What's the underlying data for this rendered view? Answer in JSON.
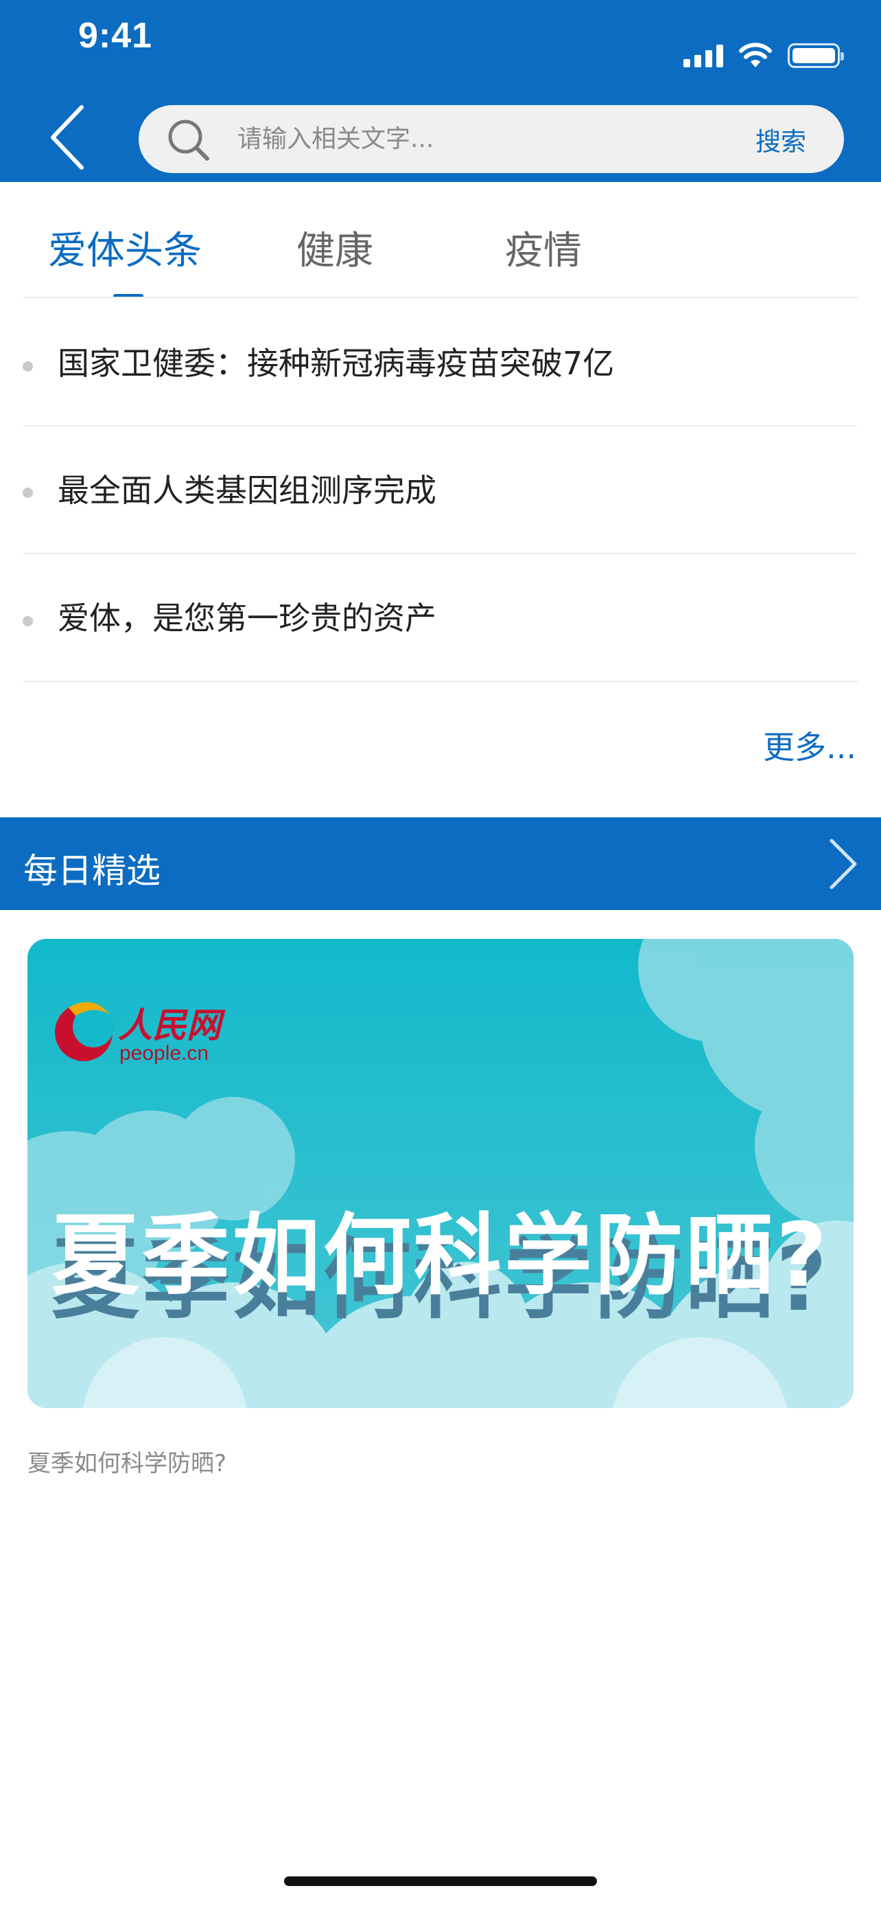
{
  "status_bar": {
    "time": "9:41",
    "icons": [
      "signal-icon",
      "wifi-icon",
      "battery-icon"
    ],
    "battery_level": 1.0
  },
  "search": {
    "placeholder": "请输入相关文字...",
    "value": "",
    "submit_label": "搜索",
    "back_icon": "chevron-left-icon",
    "search_icon": "magnifier-icon"
  },
  "tabs": [
    {
      "label": "爱体头条",
      "active": true
    },
    {
      "label": "健康",
      "active": false
    },
    {
      "label": "疫情",
      "active": false
    }
  ],
  "news": [
    {
      "title": "国家卫健委：接种新冠病毒疫苗突破7亿"
    },
    {
      "title": "最全面人类基因组测序完成"
    },
    {
      "title": "爱体，是您第一珍贵的资产"
    }
  ],
  "more_label": "更多...",
  "section": {
    "title": "每日精选",
    "arrow_icon": "chevron-right-icon"
  },
  "featured": {
    "logo_text": "人民网",
    "logo_sub": "people.cn",
    "headline": "夏季如何科学防晒?",
    "caption": "夏季如何科学防晒?"
  },
  "colors": {
    "brand": "#0b6cc1",
    "search_bg": "#f0f0f0",
    "card_bg": "#16bccc"
  }
}
